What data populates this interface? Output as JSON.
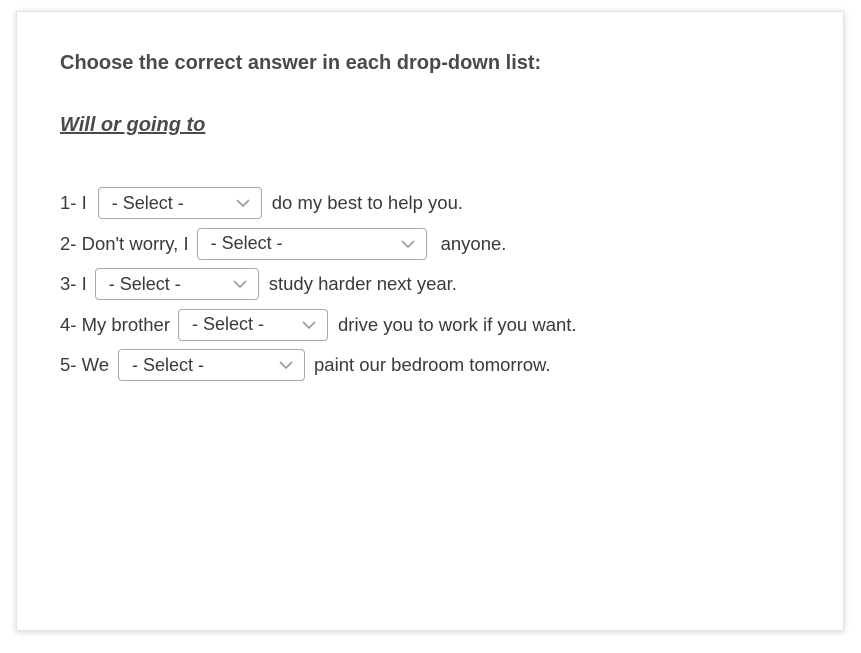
{
  "instruction": "Choose the correct answer in each drop-down list:",
  "subtitle": "Will or going to",
  "select_placeholder": "- Select -",
  "questions": [
    {
      "before": "1- I",
      "after": "do my best to help you."
    },
    {
      "before": "2- Don't worry, I",
      "after": "anyone."
    },
    {
      "before": "3-  I",
      "after": "study harder next year."
    },
    {
      "before": "4-  My brother",
      "after": "drive you to work if you want."
    },
    {
      "before": "5-  We",
      "after": "paint our bedroom tomorrow."
    }
  ],
  "icons": {
    "dropdown": "chevron-down-icon"
  },
  "colors": {
    "text": "#3a3a3a",
    "border": "#a8a8a8",
    "chevron": "#9a9a9a"
  }
}
